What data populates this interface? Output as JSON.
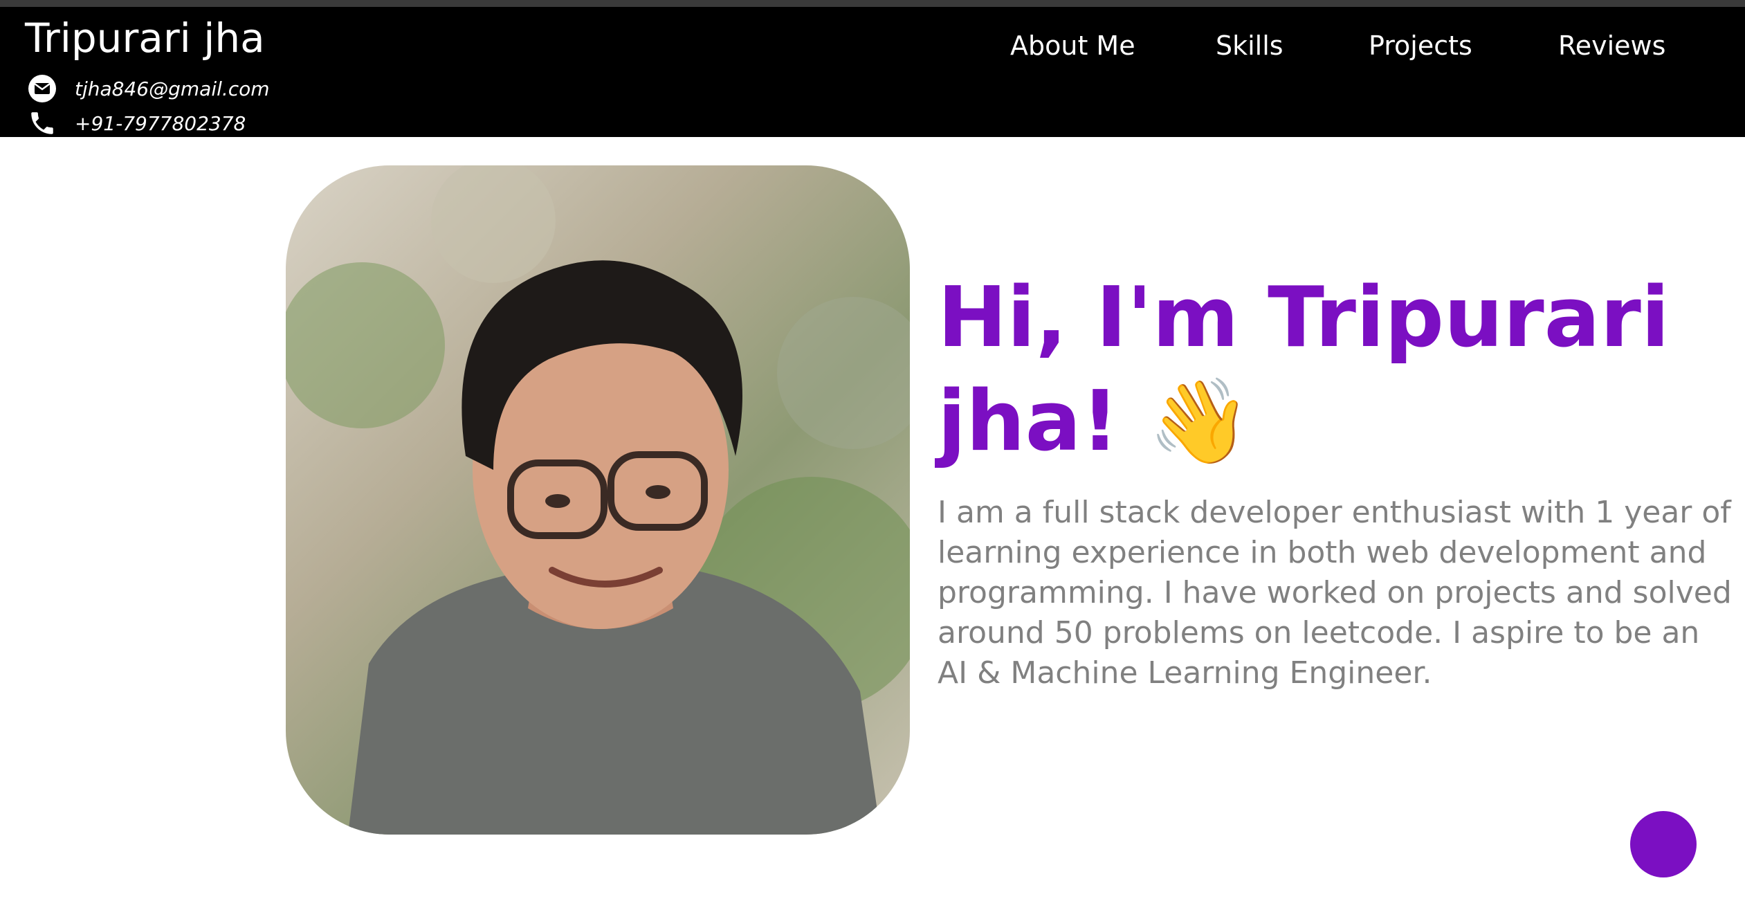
{
  "header": {
    "brand": "Tripurari jha",
    "email": "tjha846@gmail.com",
    "phone": "+91-7977802378",
    "email_icon": "mail-icon",
    "phone_icon": "phone-icon"
  },
  "nav": {
    "items": [
      {
        "label": "About Me"
      },
      {
        "label": "Skills"
      },
      {
        "label": "Projects"
      },
      {
        "label": "Reviews"
      }
    ]
  },
  "hero": {
    "title": "Hi, I'm Tripurari jha! 👋",
    "description": "I am a full stack developer enthusiast with 1 year of learning experience in both web development and programming. I have worked on projects and solved around 50 problems on leetcode. I aspire to be an AI & Machine Learning Engineer.",
    "photo_alt": "Profile photo"
  },
  "colors": {
    "accent": "#7b0fc2",
    "navbar": "#000000",
    "text_muted": "#808080"
  }
}
